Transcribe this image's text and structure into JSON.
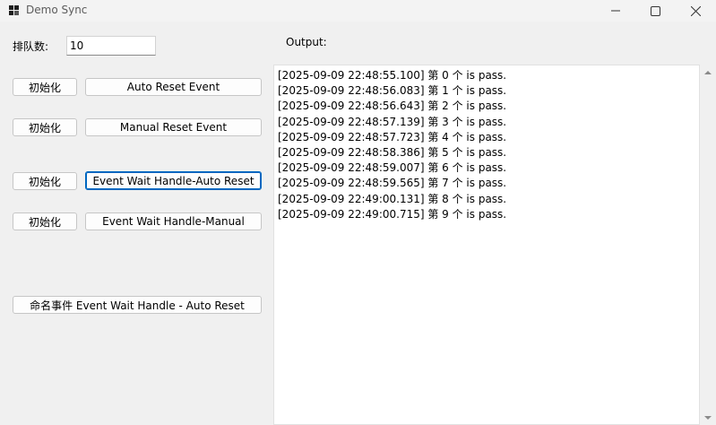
{
  "window": {
    "title": "Demo Sync"
  },
  "queue": {
    "label": "排队数:",
    "value": "10"
  },
  "output": {
    "label": "Output:",
    "lines": [
      "[2025-09-09 22:48:55.100] 第 0 个 is pass.",
      "[2025-09-09 22:48:56.083] 第 1 个 is pass.",
      "[2025-09-09 22:48:56.643] 第 2 个 is pass.",
      "[2025-09-09 22:48:57.139] 第 3 个 is pass.",
      "[2025-09-09 22:48:57.723] 第 4 个 is pass.",
      "[2025-09-09 22:48:58.386] 第 5 个 is pass.",
      "[2025-09-09 22:48:59.007] 第 6 个 is pass.",
      "[2025-09-09 22:48:59.565] 第 7 个 is pass.",
      "[2025-09-09 22:49:00.131] 第 8 个 is pass.",
      "[2025-09-09 22:49:00.715] 第 9 个 is pass."
    ]
  },
  "buttons": {
    "init_label": "初始化",
    "auto_reset": "Auto Reset Event",
    "manual_reset": "Manual Reset Event",
    "ewh_auto": "Event Wait Handle-Auto Reset",
    "ewh_manual": "Event Wait Handle-Manual",
    "named_event": "命名事件 Event Wait Handle - Auto Reset"
  },
  "colors": {
    "focus_border": "#0067c0"
  }
}
